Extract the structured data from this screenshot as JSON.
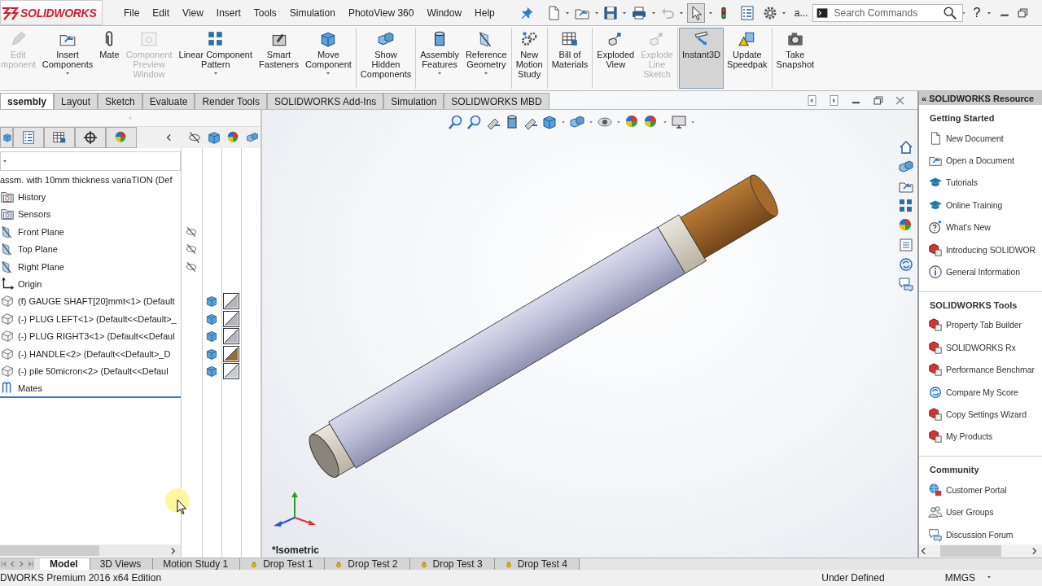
{
  "title_bar": {
    "logo": "SOLIDWORKS",
    "menus": [
      "File",
      "Edit",
      "View",
      "Insert",
      "Tools",
      "Simulation",
      "PhotoView 360",
      "Window",
      "Help"
    ],
    "overflow_label": "a...",
    "search": {
      "placeholder": "Search Commands"
    },
    "help_label": "?"
  },
  "ribbon_groups": [
    [
      {
        "label": "Edit\nmponent",
        "disabled": true,
        "dropdown": false,
        "selected": false
      },
      {
        "label": "Insert\nComponents",
        "disabled": false,
        "dropdown": true,
        "selected": false
      },
      {
        "label": "Mate",
        "disabled": false,
        "dropdown": false,
        "selected": false
      },
      {
        "label": "Component\nPreview\nWindow",
        "disabled": true,
        "dropdown": false,
        "selected": false
      },
      {
        "label": "Linear Component\nPattern",
        "disabled": false,
        "dropdown": true,
        "selected": false
      },
      {
        "label": "Smart\nFasteners",
        "disabled": false,
        "dropdown": false,
        "selected": false
      },
      {
        "label": "Move\nComponent",
        "disabled": false,
        "dropdown": true,
        "selected": false
      }
    ],
    [
      {
        "label": "Show\nHidden\nComponents",
        "disabled": false,
        "dropdown": false,
        "selected": false
      }
    ],
    [
      {
        "label": "Assembly\nFeatures",
        "disabled": false,
        "dropdown": true,
        "selected": false
      },
      {
        "label": "Reference\nGeometry",
        "disabled": false,
        "dropdown": true,
        "selected": false
      }
    ],
    [
      {
        "label": "New\nMotion\nStudy",
        "disabled": false,
        "dropdown": false,
        "selected": false
      }
    ],
    [
      {
        "label": "Bill of\nMaterials",
        "disabled": false,
        "dropdown": false,
        "selected": false
      }
    ],
    [
      {
        "label": "Exploded\nView",
        "disabled": false,
        "dropdown": false,
        "selected": false
      },
      {
        "label": "Explode\nLine\nSketch",
        "disabled": true,
        "dropdown": false,
        "selected": false
      }
    ],
    [
      {
        "label": "Instant3D",
        "disabled": false,
        "dropdown": false,
        "selected": true
      },
      {
        "label": "Update\nSpeedpak",
        "disabled": false,
        "dropdown": false,
        "selected": false
      }
    ],
    [
      {
        "label": "Take\nSnapshot",
        "disabled": false,
        "dropdown": false,
        "selected": false
      }
    ]
  ],
  "command_tabs": [
    {
      "label": "ssembly",
      "selected": true
    },
    {
      "label": "Layout",
      "selected": false
    },
    {
      "label": "Sketch",
      "selected": false
    },
    {
      "label": "Evaluate",
      "selected": false
    },
    {
      "label": "Render Tools",
      "selected": false
    },
    {
      "label": "SOLIDWORKS Add-Ins",
      "selected": false
    },
    {
      "label": "Simulation",
      "selected": false
    },
    {
      "label": "SOLIDWORKS MBD",
      "selected": false
    }
  ],
  "feature_tree": {
    "root": "assm. with 10mm thickness variaTION  (Def",
    "children": [
      {
        "kind": "history",
        "label": "History"
      },
      {
        "kind": "sensors",
        "label": "Sensors"
      },
      {
        "kind": "plane",
        "label": "Front Plane",
        "hidden": true
      },
      {
        "kind": "plane",
        "label": "Top Plane",
        "hidden": true
      },
      {
        "kind": "plane",
        "label": "Right Plane",
        "hidden": true
      },
      {
        "kind": "origin",
        "label": "Origin"
      },
      {
        "kind": "part",
        "label": "(f) GAUGE SHAFT[20]mmt<1> (Default",
        "color": "#b4b4bc"
      },
      {
        "kind": "part",
        "label": "(-) PLUG LEFT<1> (Default<<Default>_",
        "color": "#b4b4bc"
      },
      {
        "kind": "part",
        "label": "(-) PLUG RIGHT3<1> (Default<<Defaul",
        "color": "#b4b4bc"
      },
      {
        "kind": "part",
        "label": "(-) HANDLE<2> (Default<<Default>_D",
        "color": "#9a6a3a"
      },
      {
        "kind": "part",
        "label": "(-) pile 50micron<2> (Default<<Defaul",
        "color": "#c8cad8"
      },
      {
        "kind": "mates",
        "label": "Mates"
      }
    ]
  },
  "viewport": {
    "view_label": "*Isometric"
  },
  "task_pane": {
    "collapse_label": "«",
    "title": "SOLIDWORKS Resource",
    "sections": [
      {
        "title": "Getting Started",
        "items": [
          "New Document",
          "Open a Document",
          "Tutorials",
          "Online Training",
          "What's New",
          "Introducing SOLIDWOR",
          "General Information"
        ]
      },
      {
        "title": "SOLIDWORKS Tools",
        "items": [
          "Property Tab Builder",
          "SOLIDWORKS Rx",
          "Performance Benchmar",
          "Compare My Score",
          "Copy Settings Wizard",
          "My Products"
        ]
      },
      {
        "title": "Community",
        "items": [
          "Customer Portal",
          "User Groups",
          "Discussion Forum"
        ]
      }
    ]
  },
  "model_tabs": [
    {
      "label": "Model",
      "kind": "plain",
      "selected": true
    },
    {
      "label": "3D Views",
      "kind": "plain",
      "selected": false
    },
    {
      "label": "Motion Study 1",
      "kind": "plain",
      "selected": false
    },
    {
      "label": "Drop Test 1",
      "kind": "simulation",
      "selected": false
    },
    {
      "label": "Drop Test 2",
      "kind": "simulation",
      "selected": false
    },
    {
      "label": "Drop Test 3",
      "kind": "simulation",
      "selected": false
    },
    {
      "label": "Drop Test 4",
      "kind": "simulation",
      "selected": false
    }
  ],
  "status_bar": {
    "edition": "DWORKS Premium 2016 x64 Edition",
    "state": "Under Defined",
    "units": "MMGS"
  }
}
